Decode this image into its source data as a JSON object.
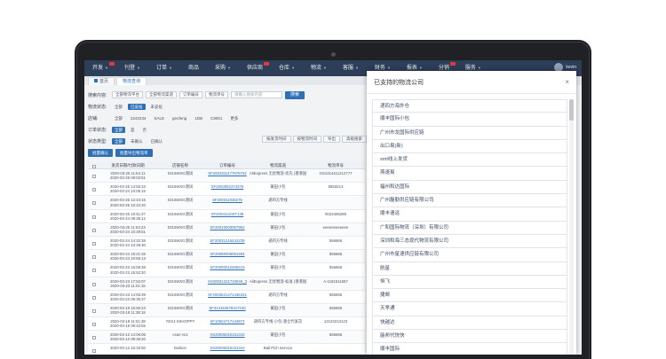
{
  "nav": {
    "items": [
      "开发",
      "刊登",
      "订单",
      "商品",
      "采购",
      "供应商",
      "仓库",
      "物流",
      "客服",
      "财务",
      "报表",
      "分销",
      "服务"
    ],
    "user": "kevin"
  },
  "tabs": [
    "首页",
    "物流查询"
  ],
  "filters": {
    "row1_label": "搜索内容:",
    "row1_select1": "全部物流平台",
    "row1_select2": "全部物流渠道",
    "row1_select3": "订单编号",
    "row1_select4": "物流单号",
    "search_placeholder": "请输入搜索内容",
    "search_button": "搜索",
    "row2_label": "物流状态:",
    "row2_chips": [
      "全部",
      "已妥投",
      "未妥投"
    ],
    "row3_label": "店铺:",
    "row3_chips": [
      "全部",
      "2242234",
      "SALE",
      "geofeng",
      "1DB",
      "C9001",
      "更多"
    ],
    "row4_label": "订单状态:",
    "row4_chips": [
      "全部",
      "是",
      "否"
    ],
    "row5_label": "状态类型:",
    "row5_chips": [
      "全部",
      "未确认",
      "已确认"
    ],
    "right_buttons": [
      "按发货时间",
      "按物流时间",
      "导出",
      "高级搜索",
      "搜索"
    ],
    "action_buttons": [
      "批量确认",
      "批量导出物流单"
    ]
  },
  "table": {
    "headers": [
      "",
      "发货日期/付款日期",
      "店铺名称",
      "订单编号",
      "物流渠道",
      "物流单号"
    ],
    "rows": [
      {
        "date1": "2020-03-25 11:54:11",
        "date2": "2020-03-25 09:03:51",
        "store": "0316WXG测试",
        "order": "SF2003311477075702",
        "channel": "AliExpress 无忧物流-优先 (香港国际小包)",
        "tracking": "GS1314411212777"
      },
      {
        "date1": "2020-03-25 13:55:33",
        "date2": "2020-03-24 10:05:15",
        "store": "0316WXG测试",
        "order": "SF2003052374376",
        "channel": "莆田小包",
        "tracking": "5553213"
      },
      {
        "date1": "2020-03-25 12:44:15",
        "date2": "2020-03-25 10:22:20",
        "store": "0316WXG测试",
        "order": "SF200311035275",
        "channel": "递四方专线",
        "tracking": ""
      },
      {
        "date1": "2020-03-25 10:51:37",
        "date2": "2020-03-24 09:36:12",
        "store": "0316WXG测试",
        "order": "SF20031110ST138",
        "channel": "莆田小包",
        "tracking": "0023405289"
      },
      {
        "date1": "2020-03-25 11:53:23",
        "date2": "2020-03-24 10:39:51",
        "store": "0316WXG测试",
        "order": "SF20010003057952",
        "channel": "莆田小包",
        "tracking": "eeeeeeeeeeee"
      },
      {
        "date1": "2020-03-24 14:32:38",
        "date2": "2020-03-24 10:39:30",
        "store": "0316WXG测试",
        "order": "SF20031215442239",
        "channel": "递四方专线",
        "tracking": "556666"
      },
      {
        "date1": "2020-03-24 19:21:28",
        "date2": "2020-03-24 10:55:13",
        "store": "0316WXG测试",
        "order": "SF20080005051284",
        "channel": "莆田小包",
        "tracking": "556666"
      },
      {
        "date1": "2020-03-23 16:59:38",
        "date2": "2020-03-23 15:52:20",
        "store": "0316WXG测试",
        "order": "SF20090012459415",
        "channel": "莆田小包",
        "tracking": "556666"
      },
      {
        "date1": "2020-03-23 17:52:07",
        "date2": "2020-03-23 11:01:16",
        "store": "0316WXG测试",
        "order": "XS20031221723045_3",
        "channel": "AliExpress 无忧物流-标准 (香港国际小包)",
        "tracking": "A-1181511557"
      },
      {
        "date1": "2020-03-23 14:55:39",
        "date2": "2020-03-23 09:35:37",
        "store": "0316WXG测试",
        "order": "SF2003521471436341",
        "channel": "递四方专线",
        "tracking": "556666"
      },
      {
        "date1": "2020-03-18 15:50:23",
        "date2": "2020-03-18 11:38:18",
        "store": "0316WXG测试",
        "order": "SF414154578417120",
        "channel": "莆田小包",
        "tracking": "556666"
      },
      {
        "date1": "2020-03-18 11:51:38",
        "date2": "2020-03-18 09:42:55",
        "store": "YESJ-XSHOPPY",
        "order": "SF10504717144874",
        "channel": "递四方专线-小包-澳仓代发货",
        "tracking": "12123213123"
      },
      {
        "date1": "2020-03-12 14:06:06",
        "date2": "2020-03-12 09:36:20",
        "store": "csan-vn1",
        "order": "XS20036015151342",
        "channel": "莆田小包",
        "tracking": "556666"
      },
      {
        "date1": "2020-03-12 16:33:50",
        "date2": "",
        "store": "fashion",
        "order": "XS20036015151342",
        "channel": "Ball Pich Service",
        "tracking": ""
      }
    ]
  },
  "modal": {
    "title": "已支持的物流公司",
    "close": "×",
    "items": [
      "递四方海外仓",
      "顺丰国际小包",
      "广州市龙国际供应链",
      "出口易(新)",
      "smt线上发货",
      "燕速易",
      "福州和达国际",
      "广州磊勤供应链有限公司",
      "顺丰速运",
      "广和国际物流（深圳）有限公司",
      "深圳和海三态现代物流有限公司",
      "广州市星速供应链有限公司",
      "航星",
      "恒飞",
      "捷邮",
      "天孝通",
      "快越达",
      "能邦代快快",
      "顺丰国际"
    ]
  }
}
